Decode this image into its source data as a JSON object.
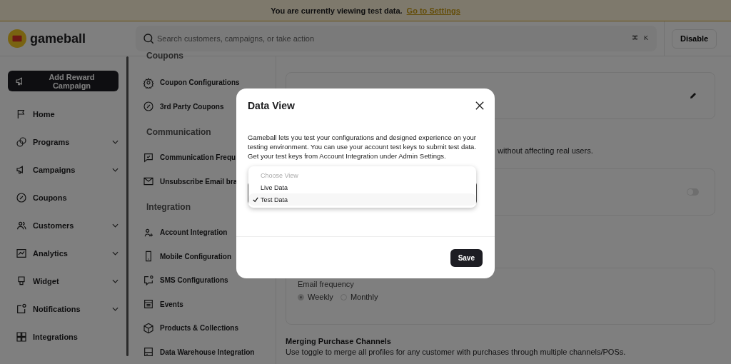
{
  "banner": {
    "text": "You are currently viewing test data.",
    "link": "Go to Settings"
  },
  "logo": {
    "name": "gameball"
  },
  "search": {
    "placeholder": "Search customers, campaigns, or take action",
    "shortcut": [
      "⌘",
      "K"
    ]
  },
  "header_button": "Disable",
  "sidebar": {
    "cta": "Add Reward Campaign",
    "items": [
      {
        "label": "Home",
        "expandable": false
      },
      {
        "label": "Programs",
        "expandable": true
      },
      {
        "label": "Campaigns",
        "expandable": true
      },
      {
        "label": "Coupons",
        "expandable": false
      },
      {
        "label": "Customers",
        "expandable": true
      },
      {
        "label": "Analytics",
        "expandable": true
      },
      {
        "label": "Widget",
        "expandable": true
      },
      {
        "label": "Notifications",
        "expandable": true
      },
      {
        "label": "Integrations",
        "expandable": false
      }
    ]
  },
  "settings_nav": {
    "sections": [
      {
        "title": "Coupons",
        "items": [
          "Coupon Configurations",
          "3rd Party Coupons"
        ]
      },
      {
        "title": "Communication",
        "items": [
          "Communication Frequ",
          "Unsubscribe Email bra"
        ]
      },
      {
        "title": "Integration",
        "items": [
          "Account Integration",
          "Mobile Configuration",
          "SMS Configurations",
          "Events",
          "Products & Collections",
          "Data Warehouse Integration"
        ]
      }
    ]
  },
  "content": {
    "note": "without affecting real users.",
    "toggle": {
      "on": false
    },
    "email_frequency": {
      "label": "Email frequency",
      "options": [
        {
          "label": "Weekly",
          "selected": true
        },
        {
          "label": "Monthly",
          "selected": false
        }
      ]
    },
    "merging": {
      "title": "Merging Purchase Channels",
      "description": "Use toggle to merge all profiles for any customer with purchases through multiple channels/POSs."
    }
  },
  "modal": {
    "title": "Data View",
    "description": "Gameball lets you test your configurations and designed experience on your testing environment. You can use your account test keys to submit test data. Get your test keys from Account Integration under Admin Settings.",
    "select": {
      "prompt": "Choose View",
      "options": [
        {
          "label": "Live Data",
          "selected": false
        },
        {
          "label": "Test Data",
          "selected": true
        }
      ]
    },
    "save": "Save"
  }
}
